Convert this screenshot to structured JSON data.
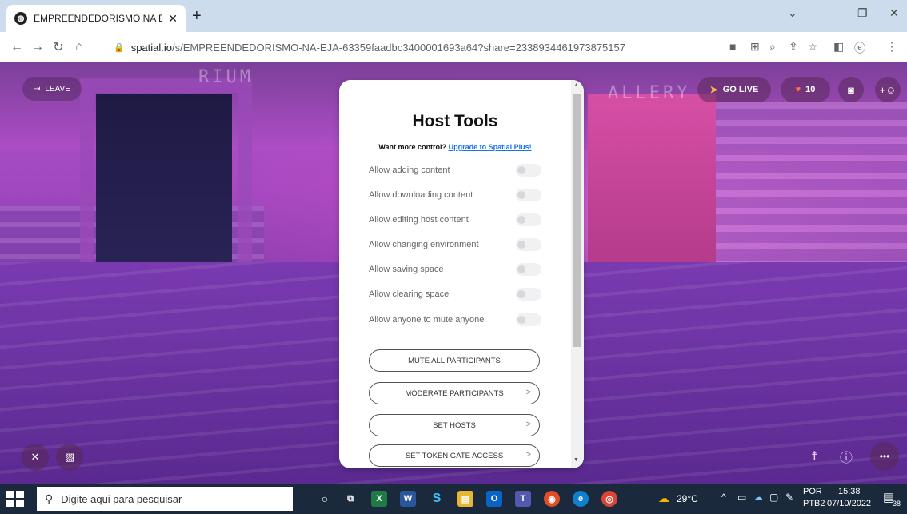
{
  "browser": {
    "tab_title": "EMPREENDEDORISMO NA EJA | S",
    "tab_favicon": "spatial-logo-icon",
    "url_domain": "spatial.io",
    "url_path": "/s/EMPREENDEDORISMO-NA-EJA-63359faadbc3400001693a64?share=2338934461973875157",
    "window_controls": [
      "chevron-down-icon",
      "minimize-icon",
      "restore-icon",
      "close-icon"
    ],
    "toolbar_icons": [
      "camera-icon",
      "translate-icon",
      "zoom-icon",
      "share-icon",
      "star-icon",
      "sidebar-icon",
      "extension-icon",
      "menu-icon"
    ]
  },
  "scene": {
    "leave_label": "LEAVE",
    "sign_left": "RIUM",
    "sign_right": "ALLERY",
    "go_live_label": "GO LIVE",
    "hearts_count": "10"
  },
  "host_tools": {
    "title": "Host Tools",
    "upgrade_prefix": "Want more control?",
    "upgrade_link": "Upgrade to Spatial Plus!",
    "settings": [
      {
        "label": "Allow adding content",
        "enabled": false
      },
      {
        "label": "Allow downloading content",
        "enabled": false
      },
      {
        "label": "Allow editing host content",
        "enabled": false
      },
      {
        "label": "Allow changing environment",
        "enabled": false
      },
      {
        "label": "Allow saving space",
        "enabled": false
      },
      {
        "label": "Allow clearing space",
        "enabled": false
      },
      {
        "label": "Allow anyone to mute anyone",
        "enabled": false
      }
    ],
    "actions": [
      {
        "label": "MUTE ALL PARTICIPANTS",
        "chevron": false
      },
      {
        "label": "MODERATE PARTICIPANTS",
        "chevron": true
      },
      {
        "label": "SET HOSTS",
        "chevron": true
      },
      {
        "label": "SET TOKEN GATE ACCESS",
        "chevron": true
      }
    ]
  },
  "taskbar": {
    "search_placeholder": "Digite aqui para pesquisar",
    "weather": "29°C",
    "lang_top": "POR",
    "lang_bottom": "PTB2",
    "time": "15:38",
    "date": "07/10/2022",
    "notifications": "38"
  }
}
